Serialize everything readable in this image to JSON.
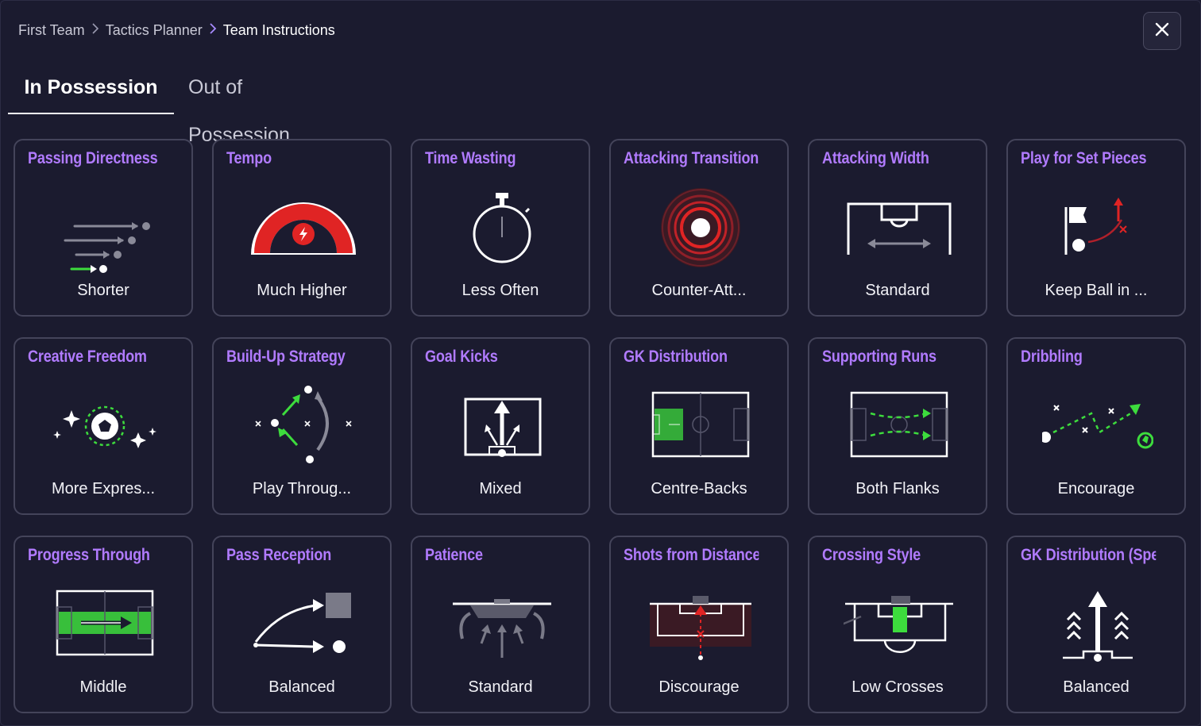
{
  "breadcrumb": {
    "items": [
      "First Team",
      "Tactics Planner",
      "Team Instructions"
    ]
  },
  "tabs": [
    {
      "label": "In Possession",
      "active": true
    },
    {
      "label": "Out of Possession",
      "active": false
    }
  ],
  "colors": {
    "accent": "#b17bff",
    "card_border": "#44445a",
    "background": "#1b1b2f",
    "green": "#3ddc3d",
    "red": "#e02424"
  },
  "cards": [
    {
      "title": "Passing Directness",
      "value": "Shorter",
      "icon": "passing-directness-icon"
    },
    {
      "title": "Tempo",
      "value": "Much Higher",
      "icon": "tempo-gauge-icon"
    },
    {
      "title": "Time Wasting",
      "value": "Less Often",
      "icon": "stopwatch-icon"
    },
    {
      "title": "Attacking Transition",
      "value": "Counter-Att...",
      "icon": "target-rings-icon"
    },
    {
      "title": "Attacking Width",
      "value": "Standard",
      "icon": "pitch-width-icon"
    },
    {
      "title": "Play for Set Pieces",
      "value": "Keep Ball in ...",
      "icon": "corner-flag-icon"
    },
    {
      "title": "Creative Freedom",
      "value": "More Expres...",
      "icon": "sparkle-ball-icon"
    },
    {
      "title": "Build-Up Strategy",
      "value": "Play Throug...",
      "icon": "build-up-arrows-icon"
    },
    {
      "title": "Goal Kicks",
      "value": "Mixed",
      "icon": "goal-kick-arrows-icon"
    },
    {
      "title": "GK Distribution",
      "value": "Centre-Backs",
      "icon": "gk-distribution-pitch-icon"
    },
    {
      "title": "Supporting Runs",
      "value": "Both Flanks",
      "icon": "supporting-runs-pitch-icon"
    },
    {
      "title": "Dribbling",
      "value": "Encourage",
      "icon": "dribbling-path-icon"
    },
    {
      "title": "Progress Through",
      "value": "Middle",
      "icon": "progress-middle-pitch-icon"
    },
    {
      "title": "Pass Reception",
      "value": "Balanced",
      "icon": "pass-reception-icon"
    },
    {
      "title": "Patience",
      "value": "Standard",
      "icon": "patience-box-icon"
    },
    {
      "title": "Shots from Distance",
      "value": "Discourage",
      "icon": "shots-distance-icon"
    },
    {
      "title": "Crossing Style",
      "value": "Low Crosses",
      "icon": "crossing-style-icon"
    },
    {
      "title": "GK Distribution (Speed)",
      "value": "Balanced",
      "icon": "gk-speed-arrows-icon"
    }
  ]
}
